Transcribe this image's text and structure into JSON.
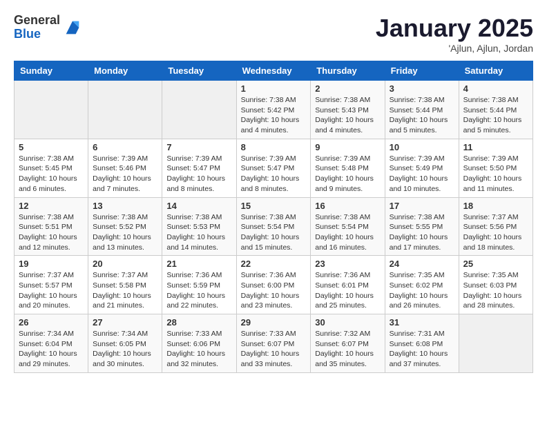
{
  "logo": {
    "general": "General",
    "blue": "Blue"
  },
  "title": "January 2025",
  "location": "'Ajlun, Ajlun, Jordan",
  "weekdays": [
    "Sunday",
    "Monday",
    "Tuesday",
    "Wednesday",
    "Thursday",
    "Friday",
    "Saturday"
  ],
  "weeks": [
    [
      {
        "day": "",
        "info": ""
      },
      {
        "day": "",
        "info": ""
      },
      {
        "day": "",
        "info": ""
      },
      {
        "day": "1",
        "info": "Sunrise: 7:38 AM\nSunset: 5:42 PM\nDaylight: 10 hours\nand 4 minutes."
      },
      {
        "day": "2",
        "info": "Sunrise: 7:38 AM\nSunset: 5:43 PM\nDaylight: 10 hours\nand 4 minutes."
      },
      {
        "day": "3",
        "info": "Sunrise: 7:38 AM\nSunset: 5:44 PM\nDaylight: 10 hours\nand 5 minutes."
      },
      {
        "day": "4",
        "info": "Sunrise: 7:38 AM\nSunset: 5:44 PM\nDaylight: 10 hours\nand 5 minutes."
      }
    ],
    [
      {
        "day": "5",
        "info": "Sunrise: 7:38 AM\nSunset: 5:45 PM\nDaylight: 10 hours\nand 6 minutes."
      },
      {
        "day": "6",
        "info": "Sunrise: 7:39 AM\nSunset: 5:46 PM\nDaylight: 10 hours\nand 7 minutes."
      },
      {
        "day": "7",
        "info": "Sunrise: 7:39 AM\nSunset: 5:47 PM\nDaylight: 10 hours\nand 8 minutes."
      },
      {
        "day": "8",
        "info": "Sunrise: 7:39 AM\nSunset: 5:47 PM\nDaylight: 10 hours\nand 8 minutes."
      },
      {
        "day": "9",
        "info": "Sunrise: 7:39 AM\nSunset: 5:48 PM\nDaylight: 10 hours\nand 9 minutes."
      },
      {
        "day": "10",
        "info": "Sunrise: 7:39 AM\nSunset: 5:49 PM\nDaylight: 10 hours\nand 10 minutes."
      },
      {
        "day": "11",
        "info": "Sunrise: 7:39 AM\nSunset: 5:50 PM\nDaylight: 10 hours\nand 11 minutes."
      }
    ],
    [
      {
        "day": "12",
        "info": "Sunrise: 7:38 AM\nSunset: 5:51 PM\nDaylight: 10 hours\nand 12 minutes."
      },
      {
        "day": "13",
        "info": "Sunrise: 7:38 AM\nSunset: 5:52 PM\nDaylight: 10 hours\nand 13 minutes."
      },
      {
        "day": "14",
        "info": "Sunrise: 7:38 AM\nSunset: 5:53 PM\nDaylight: 10 hours\nand 14 minutes."
      },
      {
        "day": "15",
        "info": "Sunrise: 7:38 AM\nSunset: 5:54 PM\nDaylight: 10 hours\nand 15 minutes."
      },
      {
        "day": "16",
        "info": "Sunrise: 7:38 AM\nSunset: 5:54 PM\nDaylight: 10 hours\nand 16 minutes."
      },
      {
        "day": "17",
        "info": "Sunrise: 7:38 AM\nSunset: 5:55 PM\nDaylight: 10 hours\nand 17 minutes."
      },
      {
        "day": "18",
        "info": "Sunrise: 7:37 AM\nSunset: 5:56 PM\nDaylight: 10 hours\nand 18 minutes."
      }
    ],
    [
      {
        "day": "19",
        "info": "Sunrise: 7:37 AM\nSunset: 5:57 PM\nDaylight: 10 hours\nand 20 minutes."
      },
      {
        "day": "20",
        "info": "Sunrise: 7:37 AM\nSunset: 5:58 PM\nDaylight: 10 hours\nand 21 minutes."
      },
      {
        "day": "21",
        "info": "Sunrise: 7:36 AM\nSunset: 5:59 PM\nDaylight: 10 hours\nand 22 minutes."
      },
      {
        "day": "22",
        "info": "Sunrise: 7:36 AM\nSunset: 6:00 PM\nDaylight: 10 hours\nand 23 minutes."
      },
      {
        "day": "23",
        "info": "Sunrise: 7:36 AM\nSunset: 6:01 PM\nDaylight: 10 hours\nand 25 minutes."
      },
      {
        "day": "24",
        "info": "Sunrise: 7:35 AM\nSunset: 6:02 PM\nDaylight: 10 hours\nand 26 minutes."
      },
      {
        "day": "25",
        "info": "Sunrise: 7:35 AM\nSunset: 6:03 PM\nDaylight: 10 hours\nand 28 minutes."
      }
    ],
    [
      {
        "day": "26",
        "info": "Sunrise: 7:34 AM\nSunset: 6:04 PM\nDaylight: 10 hours\nand 29 minutes."
      },
      {
        "day": "27",
        "info": "Sunrise: 7:34 AM\nSunset: 6:05 PM\nDaylight: 10 hours\nand 30 minutes."
      },
      {
        "day": "28",
        "info": "Sunrise: 7:33 AM\nSunset: 6:06 PM\nDaylight: 10 hours\nand 32 minutes."
      },
      {
        "day": "29",
        "info": "Sunrise: 7:33 AM\nSunset: 6:07 PM\nDaylight: 10 hours\nand 33 minutes."
      },
      {
        "day": "30",
        "info": "Sunrise: 7:32 AM\nSunset: 6:07 PM\nDaylight: 10 hours\nand 35 minutes."
      },
      {
        "day": "31",
        "info": "Sunrise: 7:31 AM\nSunset: 6:08 PM\nDaylight: 10 hours\nand 37 minutes."
      },
      {
        "day": "",
        "info": ""
      }
    ]
  ]
}
